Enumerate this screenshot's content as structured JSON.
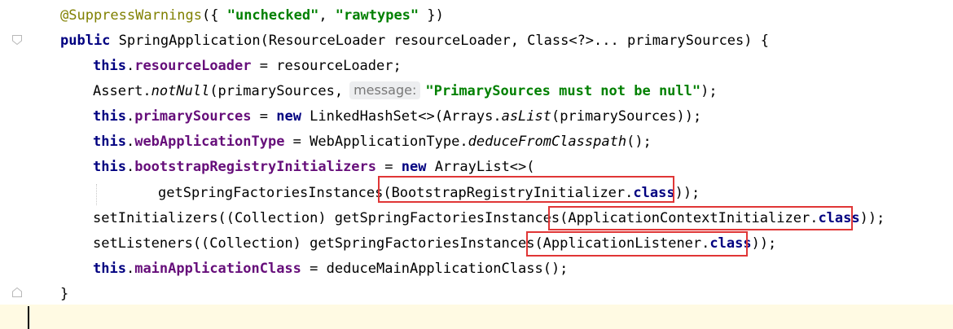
{
  "lines": [
    [
      {
        "c": "ann",
        "t": "@SuppressWarnings"
      },
      {
        "c": "",
        "t": "({ "
      },
      {
        "c": "str",
        "t": "\"unchecked\""
      },
      {
        "c": "",
        "t": ", "
      },
      {
        "c": "str",
        "t": "\"rawtypes\""
      },
      {
        "c": "",
        "t": " })"
      }
    ],
    [
      {
        "c": "kw",
        "t": "public"
      },
      {
        "c": "",
        "t": " SpringApplication(ResourceLoader resourceLoader, Class<?>... primarySources) {"
      }
    ],
    [
      {
        "c": "kw",
        "t": "this"
      },
      {
        "c": "",
        "t": "."
      },
      {
        "c": "fld",
        "t": "resourceLoader"
      },
      {
        "c": "",
        "t": " = resourceLoader;"
      }
    ],
    [
      {
        "c": "",
        "t": "Assert."
      },
      {
        "c": "it",
        "t": "notNull"
      },
      {
        "c": "",
        "t": "(primarySources,"
      },
      {
        "c": "hint",
        "t": "message:"
      },
      {
        "c": "str",
        "t": "\"PrimarySources must not be null\""
      },
      {
        "c": "",
        "t": ");"
      }
    ],
    [
      {
        "c": "kw",
        "t": "this"
      },
      {
        "c": "",
        "t": "."
      },
      {
        "c": "fld",
        "t": "primarySources"
      },
      {
        "c": "",
        "t": " = "
      },
      {
        "c": "kw",
        "t": "new"
      },
      {
        "c": "",
        "t": " LinkedHashSet<>(Arrays."
      },
      {
        "c": "it",
        "t": "asList"
      },
      {
        "c": "",
        "t": "(primarySources));"
      }
    ],
    [
      {
        "c": "kw",
        "t": "this"
      },
      {
        "c": "",
        "t": "."
      },
      {
        "c": "fld",
        "t": "webApplicationType"
      },
      {
        "c": "",
        "t": " = WebApplicationType."
      },
      {
        "c": "it",
        "t": "deduceFromClasspath"
      },
      {
        "c": "",
        "t": "();"
      }
    ],
    [
      {
        "c": "kw",
        "t": "this"
      },
      {
        "c": "",
        "t": "."
      },
      {
        "c": "fld",
        "t": "bootstrapRegistryInitializers"
      },
      {
        "c": "",
        "t": " = "
      },
      {
        "c": "kw",
        "t": "new"
      },
      {
        "c": "",
        "t": " ArrayList<>("
      }
    ],
    [
      {
        "c": "",
        "t": "getSpringFactoriesInstances(BootstrapRegistryInitializer."
      },
      {
        "c": "kw",
        "t": "class"
      },
      {
        "c": "",
        "t": "));"
      }
    ],
    [
      {
        "c": "",
        "t": "setInitializers((Collection) getSpringFactoriesInstances(ApplicationContextInitializer."
      },
      {
        "c": "kw",
        "t": "class"
      },
      {
        "c": "",
        "t": "));"
      }
    ],
    [
      {
        "c": "",
        "t": "setListeners((Collection) getSpringFactoriesInstances(ApplicationListener."
      },
      {
        "c": "kw",
        "t": "class"
      },
      {
        "c": "",
        "t": "));"
      }
    ],
    [
      {
        "c": "kw",
        "t": "this"
      },
      {
        "c": "",
        "t": "."
      },
      {
        "c": "fld",
        "t": "mainApplicationClass"
      },
      {
        "c": "",
        "t": " = deduceMainApplicationClass();"
      }
    ],
    [
      {
        "c": "",
        "t": "}"
      }
    ]
  ],
  "colors": {
    "keyword": "#000080",
    "field": "#660e7a",
    "string": "#008000",
    "annotation": "#808000",
    "highlight_box": "#e03636",
    "current_line": "#fffae3"
  },
  "icons": [
    "fold-start-icon",
    "fold-end-icon"
  ]
}
